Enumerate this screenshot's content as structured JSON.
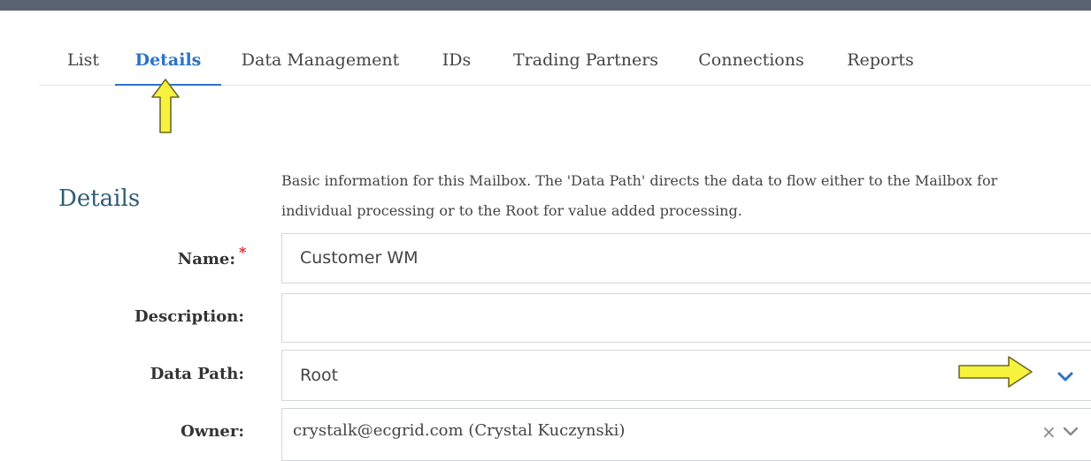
{
  "tabs": [
    {
      "label": "List"
    },
    {
      "label": "Details"
    },
    {
      "label": "Data Management"
    },
    {
      "label": "IDs"
    },
    {
      "label": "Trading Partners"
    },
    {
      "label": "Connections"
    },
    {
      "label": "Reports"
    }
  ],
  "active_tab": "Details",
  "details": {
    "title": "Details",
    "description": "Basic information for this Mailbox. The 'Data Path' directs the data to flow either to the Mailbox for individual processing or to the Root for value added processing."
  },
  "form": {
    "name_label": "Name:",
    "name_value": "Customer WM",
    "required_mark": "*",
    "description_label": "Description:",
    "description_value": "",
    "data_path_label": "Data Path:",
    "data_path_value": "Root",
    "owner_label": "Owner:",
    "owner_value": "crystalk@ecgrid.com (Crystal Kuczynski)",
    "clear_symbol": "×"
  },
  "icons": {
    "annotation_up": "arrow-up-icon",
    "annotation_right": "arrow-right-icon",
    "dropdown": "chevron-down-icon",
    "clear": "clear-icon"
  },
  "colors": {
    "accent": "#2b73c7",
    "annotation_fill": "#f7f23c",
    "annotation_stroke": "#6b6a2a",
    "required": "#d9262a",
    "section_title": "#2e5c75"
  }
}
